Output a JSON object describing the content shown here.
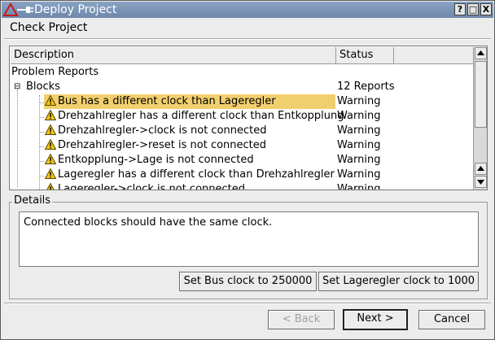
{
  "window": {
    "title": "Deploy Project",
    "buttons": [
      "?",
      "□",
      "X"
    ]
  },
  "page": {
    "heading": "Check Project"
  },
  "tree": {
    "columns": [
      "Description",
      "Status"
    ],
    "root": "Problem Reports",
    "group": {
      "label": "Blocks",
      "status": "12 Reports"
    },
    "rows": [
      {
        "description": "Bus has a different clock than Lageregler",
        "status": "Warning",
        "selected": true
      },
      {
        "description": "Drehzahlregler has a different clock than Entkopplung",
        "status": "Warning"
      },
      {
        "description": "Drehzahlregler->clock is not connected",
        "status": "Warning"
      },
      {
        "description": "Drehzahlregler->reset is not connected",
        "status": "Warning"
      },
      {
        "description": "Entkopplung->Lage is not connected",
        "status": "Warning"
      },
      {
        "description": "Lageregler has a different clock than Drehzahlregler",
        "status": "Warning"
      },
      {
        "description": "Lageregler->clock is not connected",
        "status": "Warning"
      }
    ]
  },
  "details": {
    "legend": "Details",
    "text": "Connected blocks should have the same clock.",
    "fix_button_1": "Set Bus clock to 250000",
    "fix_button_2": "Set Lageregler clock to 1000"
  },
  "footer": {
    "back": "< Back",
    "next": "Next >",
    "cancel": "Cancel"
  },
  "colors": {
    "selection": "#f2cf6e",
    "titlebar": "#7b93b6",
    "warning": "#f0c419"
  },
  "icons": {
    "row_icon": "warning-icon",
    "app_icon": "triangle-plug-icon"
  }
}
